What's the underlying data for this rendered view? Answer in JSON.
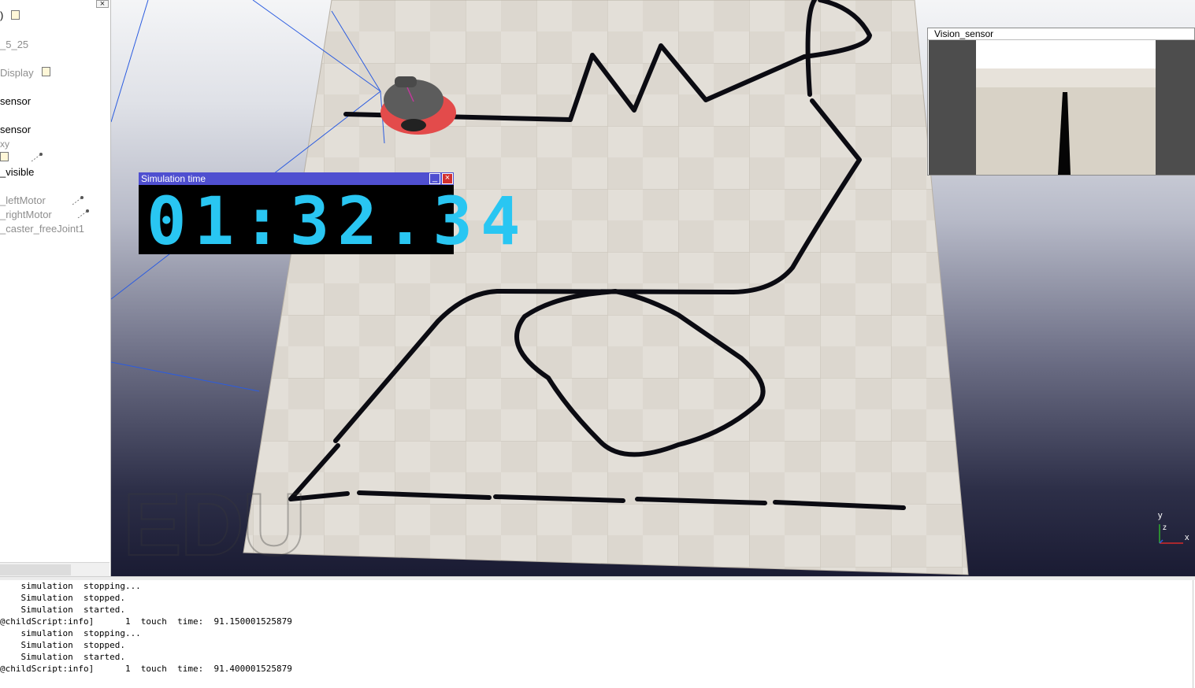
{
  "hierarchy": {
    "close_label": "×",
    "items": [
      {
        "label": ")",
        "dim": false
      },
      {
        "label": "_5_25",
        "dim": true
      },
      {
        "label": "Display",
        "dim": true
      },
      {
        "label": "sensor",
        "dim": false
      },
      {
        "label": "sensor",
        "dim": false
      },
      {
        "label": "xy",
        "dim": true
      },
      {
        "label": "_visible",
        "dim": false
      },
      {
        "label": "_leftMotor",
        "dim": true
      },
      {
        "label": "_rightMotor",
        "dim": true
      },
      {
        "label": "_caster_freeJoint1",
        "dim": true
      }
    ]
  },
  "sim_time": {
    "title": "Simulation time",
    "value": "01:32.34",
    "minimize_label": "_",
    "close_label": "×"
  },
  "vision": {
    "title": "Vision_sensor"
  },
  "watermark": "EDU",
  "axes": {
    "x": "x",
    "y": "y",
    "z": "z"
  },
  "console": {
    "lines": [
      "    simulation  stopping...",
      "    Simulation  stopped.",
      "    Simulation  started.",
      "@childScript:info]      1  touch  time:  91.150001525879",
      "    simulation  stopping...",
      "    Simulation  stopped.",
      "    Simulation  started.",
      "@childScript:info]      1  touch  time:  91.400001525879"
    ]
  },
  "colors": {
    "sim_digits": "#29c6f2",
    "sim_titlebar": "#4f4fd0",
    "floor": "#d8d2c8",
    "track": "#0b0b12"
  }
}
